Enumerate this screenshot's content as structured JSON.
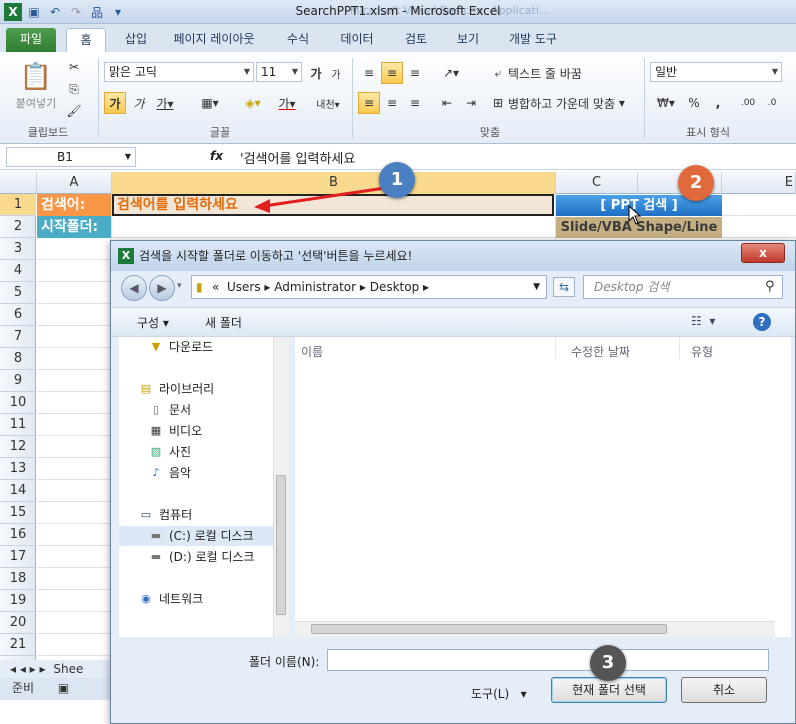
{
  "window": {
    "title": "SearchPPT1.xlsm  -  Microsoft Excel",
    "ghost_title": "Microsoft Visual Basic for Applicati..."
  },
  "ribbon": {
    "tabs": [
      "파일",
      "홈",
      "삽입",
      "페이지 레이아웃",
      "수식",
      "데이터",
      "검토",
      "보기",
      "개발 도구"
    ],
    "clipboard": {
      "paste": "붙여넣기",
      "label": "클립보드"
    },
    "font": {
      "name": "맑은 고딕",
      "size": "11",
      "label": "글꼴"
    },
    "alignment": {
      "wrap": "텍스트 줄 바꿈",
      "merge": "병합하고 가운데 맞춤",
      "label": "맞춤"
    },
    "number": {
      "format": "일반",
      "label": "표시 형식"
    }
  },
  "formula_bar": {
    "name_box": "B1",
    "fx": "fx",
    "content": "'검색어를 입력하세요"
  },
  "sheet": {
    "columns": [
      "A",
      "B",
      "C",
      "E"
    ],
    "rows": [
      "1",
      "2",
      "3",
      "4",
      "5",
      "6",
      "7",
      "8",
      "9",
      "10",
      "11",
      "12",
      "13",
      "14",
      "15",
      "16",
      "17",
      "18",
      "19",
      "20",
      "21"
    ],
    "a1": "검색어:",
    "a2": "시작폴더:",
    "b1": "검색어를 입력하세요",
    "c1": "[ PPT 검색 ]",
    "c2": "Slide/VBA Shape/Line"
  },
  "sheet_tab": "Shee",
  "status": "준비",
  "badges": [
    "1",
    "2",
    "3"
  ],
  "dialog": {
    "title": "검색을 시작할 폴더로 이동하고 '선택'버튼을 누르세요!",
    "breadcrumb": [
      "«",
      "Users",
      "Administrator",
      "Desktop"
    ],
    "search_placeholder": "Desktop 검색",
    "organize": "구성",
    "new_folder": "새 폴더",
    "columns": [
      "이름",
      "수정한 날짜",
      "유형"
    ],
    "nav": [
      "다운로드",
      "라이브러리",
      "문서",
      "비디오",
      "사진",
      "음악",
      "컴퓨터",
      "(C:) 로컬 디스크",
      "(D:) 로컬 디스크",
      "네트워크"
    ],
    "folder_label": "폴더 이름(N):",
    "tools": "도구(L)",
    "select": "현재 폴더 선택",
    "cancel": "취소",
    "close": "x"
  }
}
